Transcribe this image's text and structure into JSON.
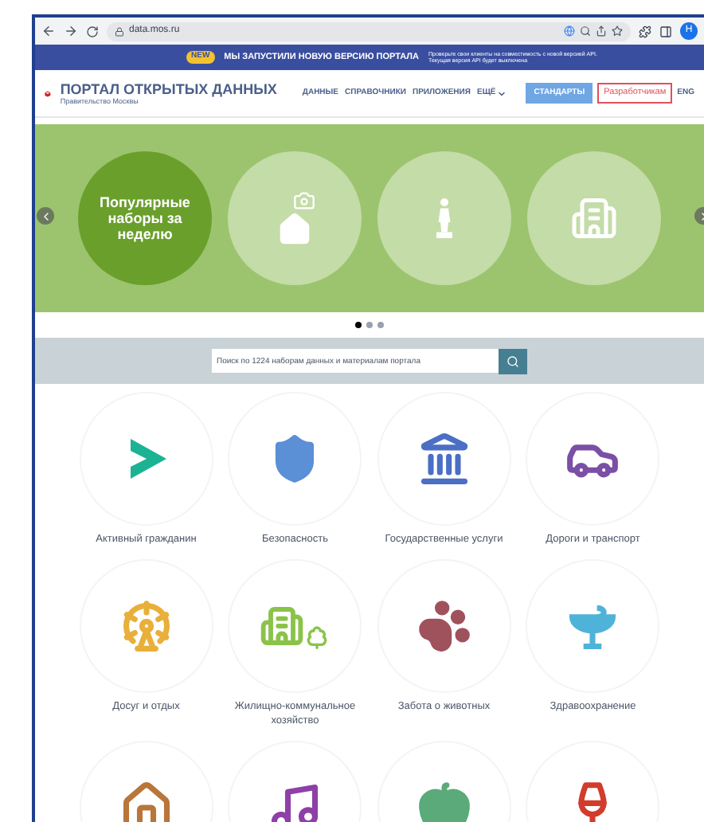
{
  "browser": {
    "url": "data.mos.ru",
    "avatar": "Н"
  },
  "banner": {
    "badge": "NEW",
    "title": "МЫ ЗАПУСТИЛИ НОВУЮ ВЕРСИЮ ПОРТАЛА",
    "note": "Проверьте свои клиенты на совместимость с новой версией API. Текущая версия API будет выключена"
  },
  "header": {
    "title": "ПОРТАЛ ОТКРЫТЫХ ДАННЫХ",
    "subtitle": "Правительство Москвы",
    "nav": [
      {
        "label": "ДАННЫЕ",
        "dropdown": false
      },
      {
        "label": "СПРАВОЧНИКИ",
        "dropdown": false
      },
      {
        "label": "ПРИЛОЖЕНИЯ",
        "dropdown": false
      },
      {
        "label": "ЕЩЁ",
        "dropdown": true
      }
    ],
    "buttons": [
      {
        "label": "СТАНДАРТЫ",
        "kind": "filled"
      },
      {
        "label": "Разработчикам",
        "kind": "outline"
      }
    ],
    "language": "ENG"
  },
  "hero": {
    "slides": [
      {
        "kind": "text",
        "text": "Популярные наборы за неделю"
      },
      {
        "kind": "icon"
      },
      {
        "kind": "icon"
      },
      {
        "kind": "icon"
      }
    ],
    "dots": [
      {
        "selected": true
      },
      {
        "selected": false
      },
      {
        "selected": false
      }
    ]
  },
  "search": {
    "placeholder": "Поиск по 1224 наборам данных и материалам портала"
  },
  "categories": [
    {
      "label": "Активный гражданин",
      "color": "#1bb394"
    },
    {
      "label": "Безопасность",
      "color": "#5b8fd6"
    },
    {
      "label": "Государственные услуги",
      "color": "#4a6fc4"
    },
    {
      "label": "Дороги и транспорт",
      "color": "#7b4fa6"
    },
    {
      "label": "Досуг и отдых",
      "color": "#e8b03a"
    },
    {
      "label": "Жилищно-коммунальное хозяйство",
      "color": "#8bc34a"
    },
    {
      "label": "Забота о животных",
      "color": "#a0525c"
    },
    {
      "label": "Здравоохранение",
      "color": "#4fb3d9"
    },
    {
      "color": "#b8763a"
    },
    {
      "color": "#8e3fa8"
    },
    {
      "color": "#5aaa7a"
    },
    {
      "color": "#d23c2c"
    }
  ]
}
